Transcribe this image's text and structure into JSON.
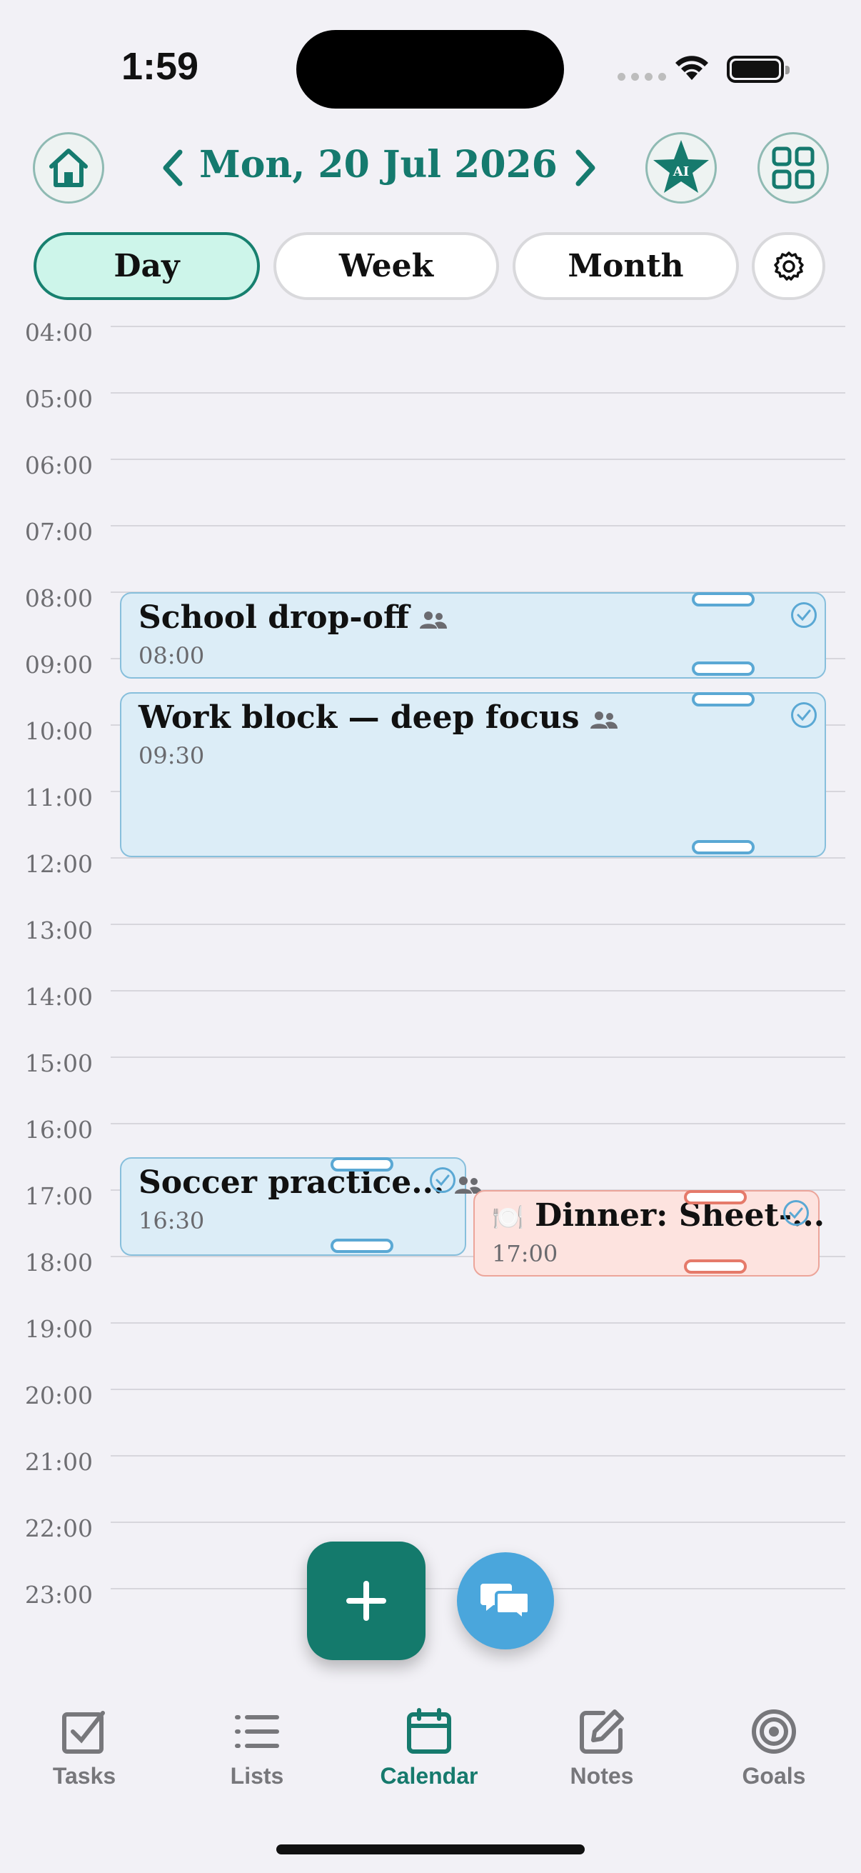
{
  "status_bar": {
    "time": "1:59"
  },
  "header": {
    "date": "Mon, 20 Jul 2026",
    "ai_badge": "AI"
  },
  "view_tabs": [
    {
      "label": "Day",
      "active": true
    },
    {
      "label": "Week",
      "active": false
    },
    {
      "label": "Month",
      "active": false
    }
  ],
  "timeline": {
    "hours": [
      "04:00",
      "05:00",
      "06:00",
      "07:00",
      "08:00",
      "09:00",
      "10:00",
      "11:00",
      "12:00",
      "13:00",
      "14:00",
      "15:00",
      "16:00",
      "17:00",
      "18:00",
      "19:00",
      "20:00",
      "21:00",
      "22:00",
      "23:00"
    ]
  },
  "events": [
    {
      "title": "School drop-off",
      "time": "08:00",
      "shared": true,
      "color": "#dcedf7"
    },
    {
      "title": "Work block — deep focus",
      "time": "09:30",
      "shared": true,
      "color": "#dcedf7"
    },
    {
      "title": "Soccer practice...",
      "time": "16:30",
      "shared": true,
      "color": "#dcedf7"
    },
    {
      "title": "Dinner: Sheet-...",
      "time": "17:00",
      "emoji": "🍽️",
      "color": "#fde3df"
    }
  ],
  "tab_bar": [
    {
      "label": "Tasks",
      "icon": "checkbox-icon",
      "active": false
    },
    {
      "label": "Lists",
      "icon": "list-icon",
      "active": false
    },
    {
      "label": "Calendar",
      "icon": "calendar-icon",
      "active": true
    },
    {
      "label": "Notes",
      "icon": "note-edit-icon",
      "active": false
    },
    {
      "label": "Goals",
      "icon": "target-icon",
      "active": false
    }
  ],
  "colors": {
    "accent": "#147a6c",
    "event_blue": "#dcedf7",
    "event_red": "#fde3df",
    "chat_fab": "#4aa6dc"
  }
}
